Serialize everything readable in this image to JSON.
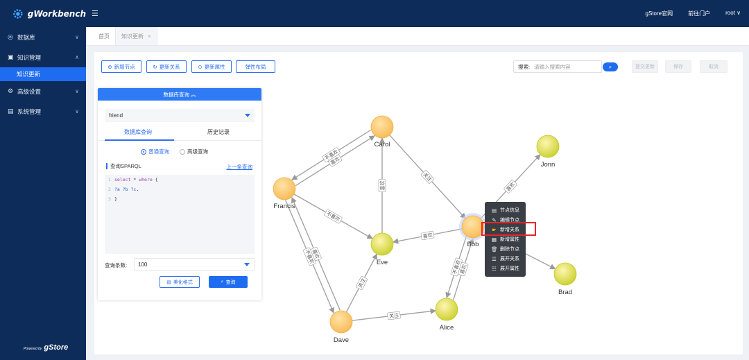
{
  "app": {
    "logo_text": "gWorkbench",
    "powered_small": "Powered by",
    "powered_brand": "gStore"
  },
  "topbar": {
    "links": [
      "gStore官网",
      "前往门户",
      "root ∨"
    ]
  },
  "sidebar": {
    "items": [
      {
        "label": "数据库",
        "icon": "database-icon",
        "chevron": "∨"
      },
      {
        "label": "知识管理",
        "icon": "knowledge-icon",
        "chevron": "∧"
      },
      {
        "label": "知识更新",
        "sub": true
      },
      {
        "label": "高级设置",
        "icon": "settings-icon",
        "chevron": "∨"
      },
      {
        "label": "系统管理",
        "icon": "system-icon",
        "chevron": "∨"
      }
    ]
  },
  "tabs": [
    {
      "label": "首页"
    },
    {
      "label": "知识更新",
      "close": "×"
    }
  ],
  "toolbar": {
    "add_node": "新增节点",
    "update_relation": "更新关系",
    "update_property": "更新属性",
    "elastic_layout": "弹性布局",
    "search_label": "搜索:",
    "search_placeholder": "请输入搜索内容",
    "commit": "提交更新",
    "save": "保存",
    "cancel": "取消"
  },
  "query_panel": {
    "header": "数据库查询",
    "database": "friend",
    "tab_query": "数据库查询",
    "tab_history": "历史记录",
    "radio_normal": "普通查询",
    "radio_advanced": "高级查询",
    "sparql_label": "查询SPARQL",
    "prev_link": "上一条查询",
    "code": [
      {
        "ln": "1",
        "parts": [
          [
            "kw",
            "select"
          ],
          [
            "",
            " * "
          ],
          [
            "kw",
            "where"
          ],
          [
            "",
            " {"
          ]
        ]
      },
      {
        "ln": "2",
        "parts": [
          [
            "vr",
            "?a ?b ?c"
          ],
          [
            "",
            "."
          ]
        ]
      },
      {
        "ln": "3",
        "parts": [
          [
            "",
            "}"
          ]
        ]
      }
    ],
    "limit_label": "查询条数:",
    "limit_value": "100",
    "format_button": "美化格式",
    "query_button": "查询"
  },
  "graph": {
    "nodes": [
      {
        "id": "Carol",
        "label": "Carol",
        "color": "#fdc86a"
      },
      {
        "id": "Francis",
        "label": "Francis",
        "color": "#fdc86a"
      },
      {
        "id": "Eve",
        "label": "Eve",
        "color": "#d6dd3a"
      },
      {
        "id": "Bob",
        "label": "Bob",
        "color": "#fdc86a"
      },
      {
        "id": "Jonn",
        "label": "Jonn",
        "color": "#d6dd3a"
      },
      {
        "id": "Brad",
        "label": "Brad",
        "color": "#d6dd3a"
      },
      {
        "id": "Dave",
        "label": "Dave",
        "color": "#fdc86a"
      },
      {
        "id": "Alice",
        "label": "Alice",
        "color": "#d6dd3a"
      }
    ],
    "edges": [
      {
        "from": "Carol",
        "to": "Francis",
        "label": "不喜欢"
      },
      {
        "from": "Francis",
        "to": "Carol",
        "label": "喜欢"
      },
      {
        "from": "Eve",
        "to": "Carol",
        "label": "喜欢"
      },
      {
        "from": "Carol",
        "to": "Bob",
        "label": "关注"
      },
      {
        "from": "Francis",
        "to": "Eve",
        "label": "不喜欢"
      },
      {
        "from": "Bob",
        "to": "Eve",
        "label": "喜欢"
      },
      {
        "from": "Bob",
        "to": "Jonn",
        "label": "喜欢"
      },
      {
        "from": "Bob",
        "to": "Brad",
        "label": ""
      },
      {
        "from": "Francis",
        "to": "Dave",
        "label": "不喜欢"
      },
      {
        "from": "Dave",
        "to": "Francis",
        "label": "喜欢"
      },
      {
        "from": "Dave",
        "to": "Eve",
        "label": "关注"
      },
      {
        "from": "Dave",
        "to": "Alice",
        "label": "关注"
      },
      {
        "from": "Bob",
        "to": "Alice",
        "label": "不喜欢"
      },
      {
        "from": "Alice",
        "to": "Bob",
        "label": "喜欢"
      }
    ]
  },
  "context_menu": {
    "items": [
      {
        "label": "节点信息",
        "icon": "info-icon"
      },
      {
        "label": "编辑节点",
        "icon": "edit-icon"
      },
      {
        "label": "新增关系",
        "icon": "add-relation-icon",
        "highlight": true
      },
      {
        "label": "新增属性",
        "icon": "add-property-icon"
      },
      {
        "label": "删除节点",
        "icon": "delete-icon"
      },
      {
        "label": "展开关系",
        "icon": "expand-relation-icon"
      },
      {
        "label": "展开属性",
        "icon": "expand-property-icon"
      }
    ]
  }
}
